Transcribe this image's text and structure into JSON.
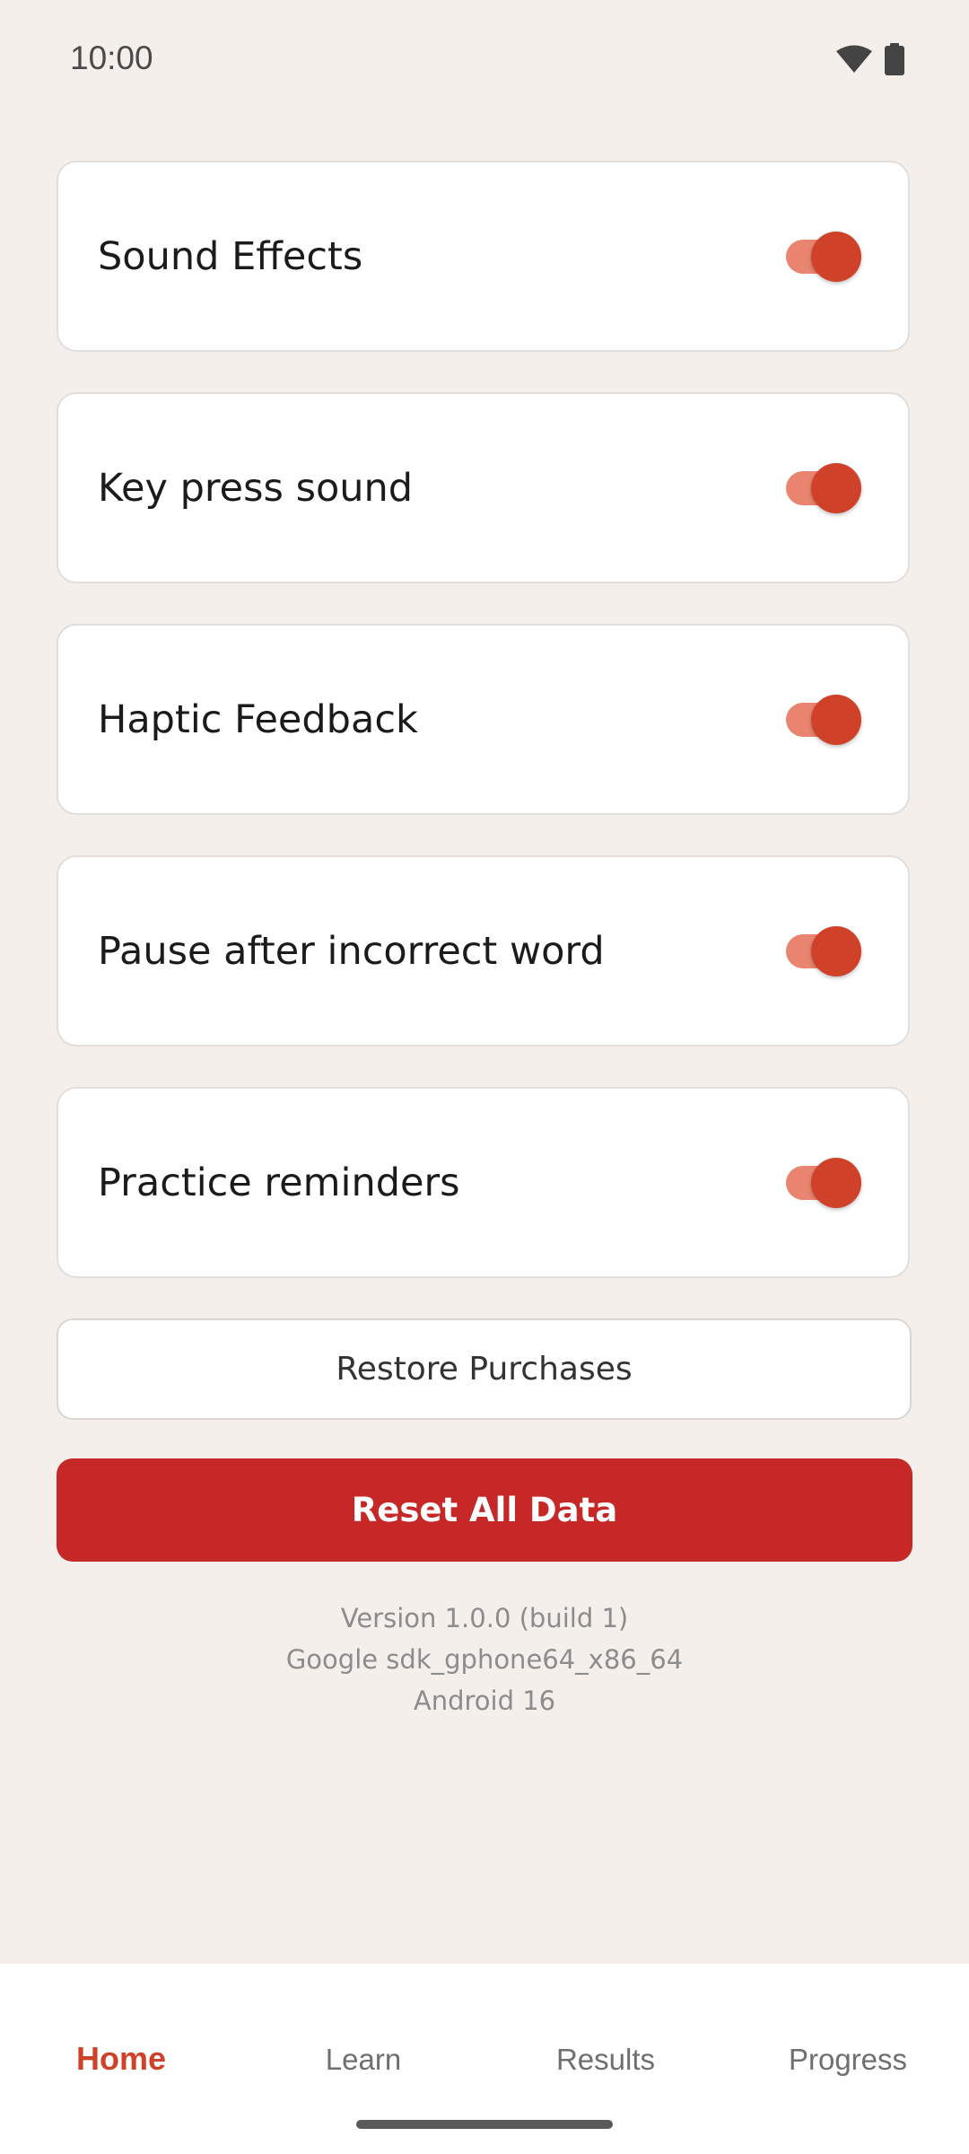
{
  "status_bar": {
    "time": "10:00",
    "icons": [
      "wifi-icon",
      "battery-icon"
    ]
  },
  "settings": [
    {
      "label": "Sound Effects",
      "enabled": true
    },
    {
      "label": "Key press sound",
      "enabled": true
    },
    {
      "label": "Haptic Feedback",
      "enabled": true
    },
    {
      "label": "Pause after incorrect word",
      "enabled": true
    },
    {
      "label": "Practice reminders",
      "enabled": true
    }
  ],
  "actions": {
    "restore_label": "Restore Purchases",
    "reset_label": "Reset All Data"
  },
  "info": {
    "version": "Version 1.0.0 (build 1)",
    "device": "Google sdk_gphone64_x86_64",
    "os": "Android 16"
  },
  "nav": {
    "tabs": [
      {
        "label": "Home",
        "active": true
      },
      {
        "label": "Learn",
        "active": false
      },
      {
        "label": "Results",
        "active": false
      },
      {
        "label": "Progress",
        "active": false
      }
    ]
  },
  "colors": {
    "background": "#f4efeb",
    "accent": "#cf4129",
    "toggle_track": "#e8846f",
    "danger": "#c62828"
  }
}
